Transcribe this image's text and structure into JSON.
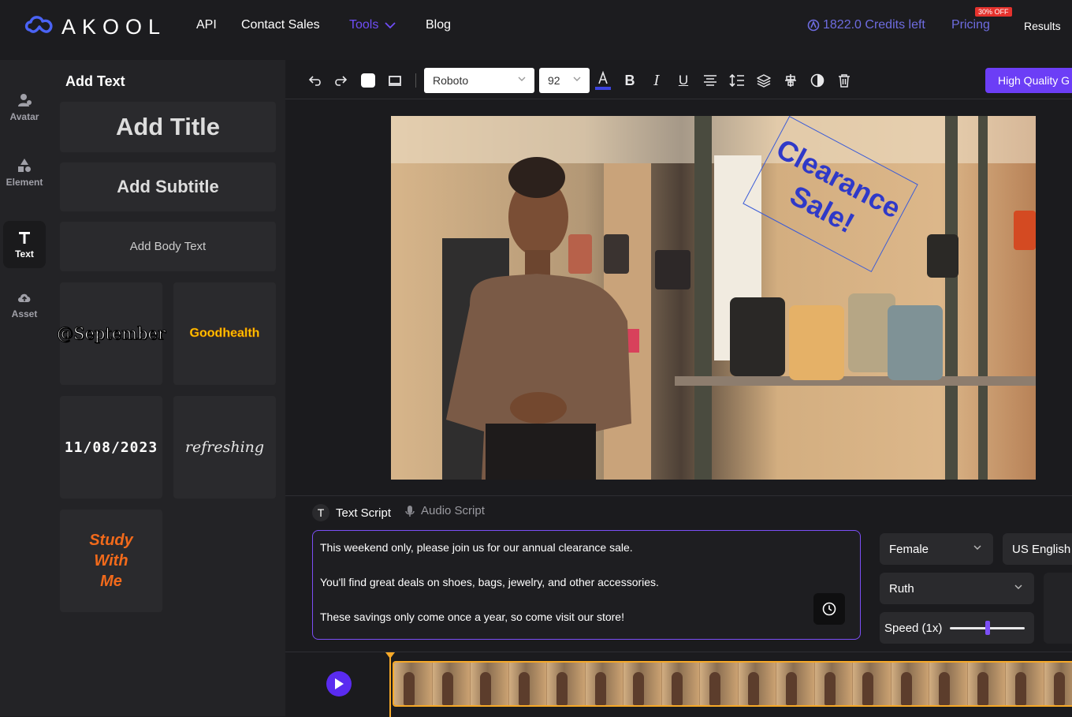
{
  "nav": {
    "brand": "AKOOL",
    "links": [
      "API",
      "Contact Sales",
      "Tools",
      "Blog"
    ],
    "credits": "1822.0 Credits left",
    "pricing": "Pricing",
    "discount_badge": "30% OFF",
    "results": "Results"
  },
  "sidebar": {
    "items": [
      {
        "label": "Avatar",
        "icon": "avatar-icon"
      },
      {
        "label": "Element",
        "icon": "shapes-icon"
      },
      {
        "label": "Text",
        "icon": "text-icon"
      },
      {
        "label": "Asset",
        "icon": "cloud-upload-icon"
      }
    ]
  },
  "panel": {
    "title": "Add Text",
    "add_title": "Add Title",
    "add_subtitle": "Add Subtitle",
    "add_body": "Add Body Text",
    "presets": [
      "@September",
      "Goodhealth",
      "11/08/2023",
      "refreshing",
      "Study\nWith\nMe"
    ]
  },
  "toolbar": {
    "font": "Roboto",
    "font_size": "92",
    "hq_button": "High Quality G"
  },
  "canvas": {
    "overlay_text_line1": "Clearance",
    "overlay_text_line2": "Sale!"
  },
  "script": {
    "tab_text": "Text Script",
    "tab_audio": "Audio Script",
    "lines": [
      "This weekend only, please join us for our annual clearance sale.",
      "You'll find great deals on shoes, bags, jewelry, and other accessories.",
      "These savings only come once a year, so come visit our store!"
    ],
    "gender": "Female",
    "language": "US English",
    "voice": "Ruth",
    "speed": "Speed (1x)",
    "speed_value": 0.5
  },
  "colors": {
    "accent": "#6c3ef6",
    "playhead": "#f7a928",
    "credits": "#6e6ce0"
  }
}
